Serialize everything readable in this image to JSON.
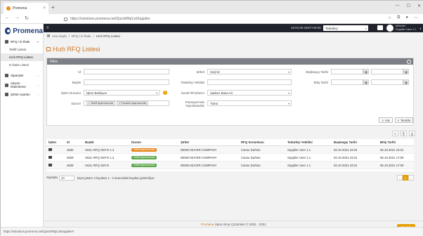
{
  "browser": {
    "tab_title": "Promena",
    "url": "https://solutions.promena.net/QuickRfq/ListSupplier",
    "status_url": "https://solutions.promena.net/QuickRfq/ListSupplier#"
  },
  "sidebar": {
    "logo": "Promena",
    "groups": [
      {
        "label": "RFQ / E-İhale",
        "items": [
          "Teklif Listesi",
          "Hızlı RFQ Listesi",
          "E-ihale Listesi"
        ]
      },
      {
        "label": "Siparişler"
      },
      {
        "label": "Akışım Ödemleme"
      },
      {
        "label": "Şirket Ayarları"
      }
    ]
  },
  "header": {
    "time": "23:01:00 GMT+03:00",
    "role_select": "Tedarikçi",
    "user_name": "Mehmet",
    "user_company": "Supplier User 1.1"
  },
  "breadcrumb": [
    "Ana Sayfa",
    "RFQ / E-İhale",
    "Hızlı RFQ Listesi"
  ],
  "page": {
    "title": "Hızlı RFQ Listesi"
  },
  "filters": {
    "panel_title": "Filtre",
    "labels": {
      "id": "Id",
      "title": "Başlık",
      "status": "İşlem Durumu",
      "state": "Durum",
      "company": "Şirket",
      "supplier_officer": "Tedarikçi Yetkilisi",
      "my_rfq": "Kendi RFQ'larım",
      "market": "Pazaryeri'nde Yayınlananlar",
      "start_date": "Başlangıç Tarihi",
      "end_date": "Bitiş Tarihi"
    },
    "values": {
      "status": "İşlem Bekleyen",
      "state_tags": [
        "Teklif Ayarmasında",
        "Pazarlık Aşamasında"
      ],
      "company": "Seçiniz",
      "my_rfq": "Sadece Bana Ait",
      "market": "Tümü"
    },
    "search_button": "Ara",
    "clear_button": "Temizle"
  },
  "table": {
    "columns": [
      "İşlem",
      "Id",
      "Başlık",
      "Durum",
      "Şirket",
      "RFQ Sorumlusu",
      "Tedarikçi Yetkilisi",
      "Başlangıç Tarihi",
      "Bitiş Tarihi"
    ],
    "rows": [
      {
        "id": "4830",
        "title": "HIZLI RFQ SDYO 1.4",
        "status": "Teklif Ayarmasında",
        "status_color": "#e8871a",
        "company": "DEMO BUYER COMPANY",
        "owner": "Cansu Durhan",
        "officer": "Supplier User 1.1",
        "start": "02.10.2021 23:34",
        "end": "05.10.2021 23:31"
      },
      {
        "id": "4829",
        "title": "HIZLI RFQ SDYO 1.3",
        "status": "Teklif Ayarmasında",
        "status_color": "#5ba84a",
        "company": "DEMO BUYER COMPANY",
        "owner": "Cansu Durhan",
        "officer": "Supplier User 1.1",
        "start": "02.10.2021 23:31",
        "end": "05.10.2021 17:00"
      },
      {
        "id": "4828",
        "title": "HIZLI RFQ SDYO",
        "status": "Teklif Ayarmasında",
        "status_color": "#5ba84a",
        "company": "DEMO BUYER COMPANY",
        "owner": "Cansu Durhan",
        "officer": "Supplier User 1.1",
        "start": "02.10.2021 23:31",
        "end": "05.10.2021 17:00"
      }
    ]
  },
  "pagination": {
    "page_size_label": "Sayfada",
    "page_size": "10",
    "info": "kayıt göster  3 kayıttan 1 - 3 arasındaki kayıtlar gösteriliyor",
    "prev": "‹",
    "current": "1",
    "next": "›"
  },
  "footer": {
    "brand": "Promena",
    "text": "Satın Alma Çözümleri © 2001 - 2021"
  },
  "help_button": "Destek"
}
